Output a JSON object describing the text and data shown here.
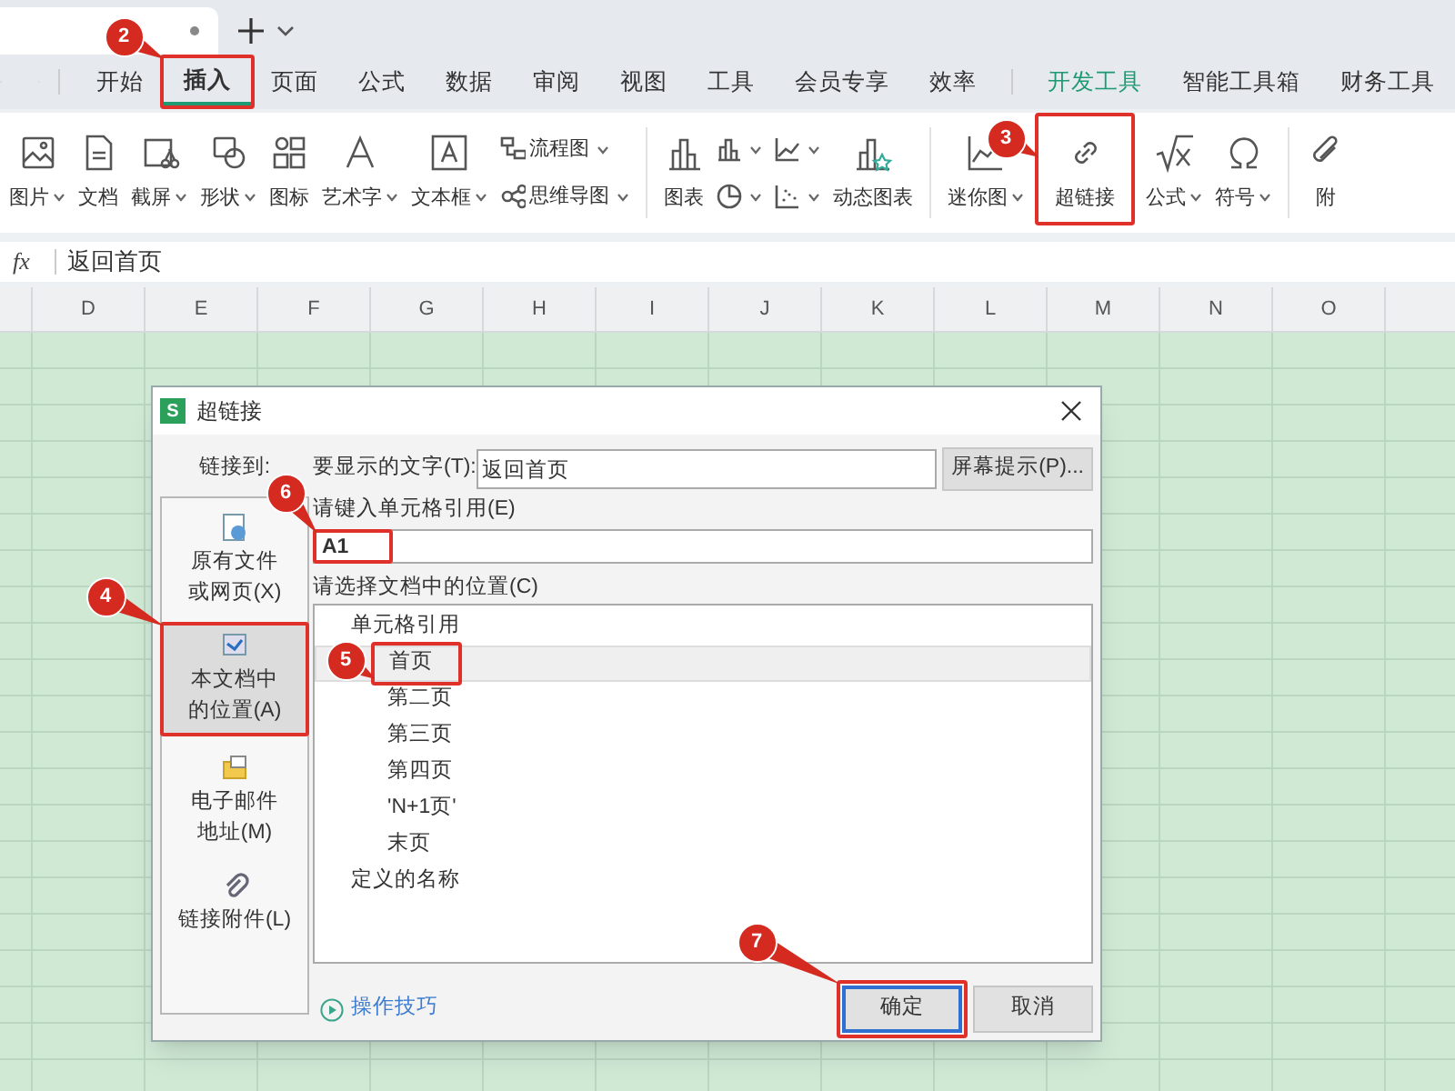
{
  "menu_tabs": [
    {
      "label": "开始",
      "selected": false,
      "emphasized": false
    },
    {
      "label": "插入",
      "selected": true,
      "emphasized": false,
      "callout": "2"
    },
    {
      "label": "页面",
      "selected": false,
      "emphasized": false
    },
    {
      "label": "公式",
      "selected": false,
      "emphasized": false
    },
    {
      "label": "数据",
      "selected": false,
      "emphasized": false
    },
    {
      "label": "审阅",
      "selected": false,
      "emphasized": false
    },
    {
      "label": "视图",
      "selected": false,
      "emphasized": false
    },
    {
      "label": "工具",
      "selected": false,
      "emphasized": false
    },
    {
      "label": "会员专享",
      "selected": false,
      "emphasized": false
    },
    {
      "label": "效率",
      "selected": false,
      "emphasized": false
    },
    {
      "label": "开发工具",
      "selected": false,
      "emphasized": true
    },
    {
      "label": "智能工具箱",
      "selected": false,
      "emphasized": false
    },
    {
      "label": "财务工具",
      "selected": false,
      "emphasized": false
    }
  ],
  "ribbon_groups": [
    {
      "items": [
        {
          "kind": "large",
          "label": "图片",
          "dropdown": true
        },
        {
          "kind": "large",
          "label": "文档",
          "dropdown": false
        },
        {
          "kind": "large",
          "label": "截屏",
          "dropdown": true
        },
        {
          "kind": "large",
          "label": "形状",
          "dropdown": true
        },
        {
          "kind": "large",
          "label": "图标",
          "dropdown": false
        },
        {
          "kind": "large",
          "label": "艺术字",
          "dropdown": true
        },
        {
          "kind": "large",
          "label": "文本框",
          "dropdown": true
        },
        {
          "kind": "stack",
          "items": [
            {
              "label": "流程图",
              "dropdown": true
            },
            {
              "label": "思维导图",
              "dropdown": true
            }
          ]
        }
      ]
    },
    {
      "items": [
        {
          "kind": "large",
          "label": "图表",
          "dropdown": false
        },
        {
          "kind": "stack",
          "items": [
            {
              "dropdown": true
            },
            {
              "dropdown": true
            }
          ]
        },
        {
          "kind": "stack",
          "items": [
            {
              "dropdown": true
            },
            {
              "dropdown": true
            }
          ]
        },
        {
          "kind": "large",
          "label": "动态图表",
          "dropdown": false
        }
      ]
    },
    {
      "items": [
        {
          "kind": "large",
          "label": "迷你图",
          "dropdown": true
        },
        {
          "kind": "large",
          "label": "超链接",
          "dropdown": false,
          "callout": "3"
        },
        {
          "kind": "large",
          "label": "公式",
          "dropdown": true
        },
        {
          "kind": "large",
          "label": "符号",
          "dropdown": true
        }
      ]
    },
    {
      "items": [
        {
          "kind": "large",
          "label": "附",
          "dropdown": false
        }
      ]
    }
  ],
  "formula_bar": {
    "function_label": "fx",
    "value": "返回首页"
  },
  "columns": [
    "D",
    "E",
    "F",
    "G",
    "H",
    "I",
    "J",
    "K",
    "L",
    "M",
    "N",
    "O"
  ],
  "dialog": {
    "app_badge": "S",
    "title": "超链接",
    "link_to_label": "链接到:",
    "link_targets": [
      {
        "lines": [
          "原有文件",
          "或网页(X)"
        ],
        "selected": false
      },
      {
        "lines": [
          "本文档中",
          "的位置(A)"
        ],
        "selected": true,
        "callout": "4"
      },
      {
        "lines": [
          "电子邮件",
          "地址(M)"
        ],
        "selected": false
      },
      {
        "lines": [
          "链接附件(L)"
        ],
        "selected": false
      }
    ],
    "display_text": {
      "label": "要显示的文字(T):",
      "value": "返回首页"
    },
    "screen_tip_button": "屏幕提示(P)...",
    "cell_reference": {
      "label": "请键入单元格引用(E)",
      "value": "A1",
      "callout": "6"
    },
    "location": {
      "label": "请选择文档中的位置(C)",
      "tree": [
        {
          "label": "单元格引用",
          "selected": false,
          "children": [
            {
              "label": "首页",
              "selected": true,
              "callout": "5"
            },
            {
              "label": "第二页",
              "selected": false
            },
            {
              "label": "第三页",
              "selected": false
            },
            {
              "label": "第四页",
              "selected": false
            },
            {
              "label": "'N+1页'",
              "selected": false
            },
            {
              "label": "末页",
              "selected": false
            }
          ]
        },
        {
          "label": "定义的名称",
          "selected": false
        }
      ]
    },
    "tips_link": "操作技巧",
    "buttons": [
      {
        "label": "确定",
        "kind": "primary",
        "callout": "7"
      },
      {
        "label": "取消",
        "kind": "secondary"
      }
    ]
  }
}
